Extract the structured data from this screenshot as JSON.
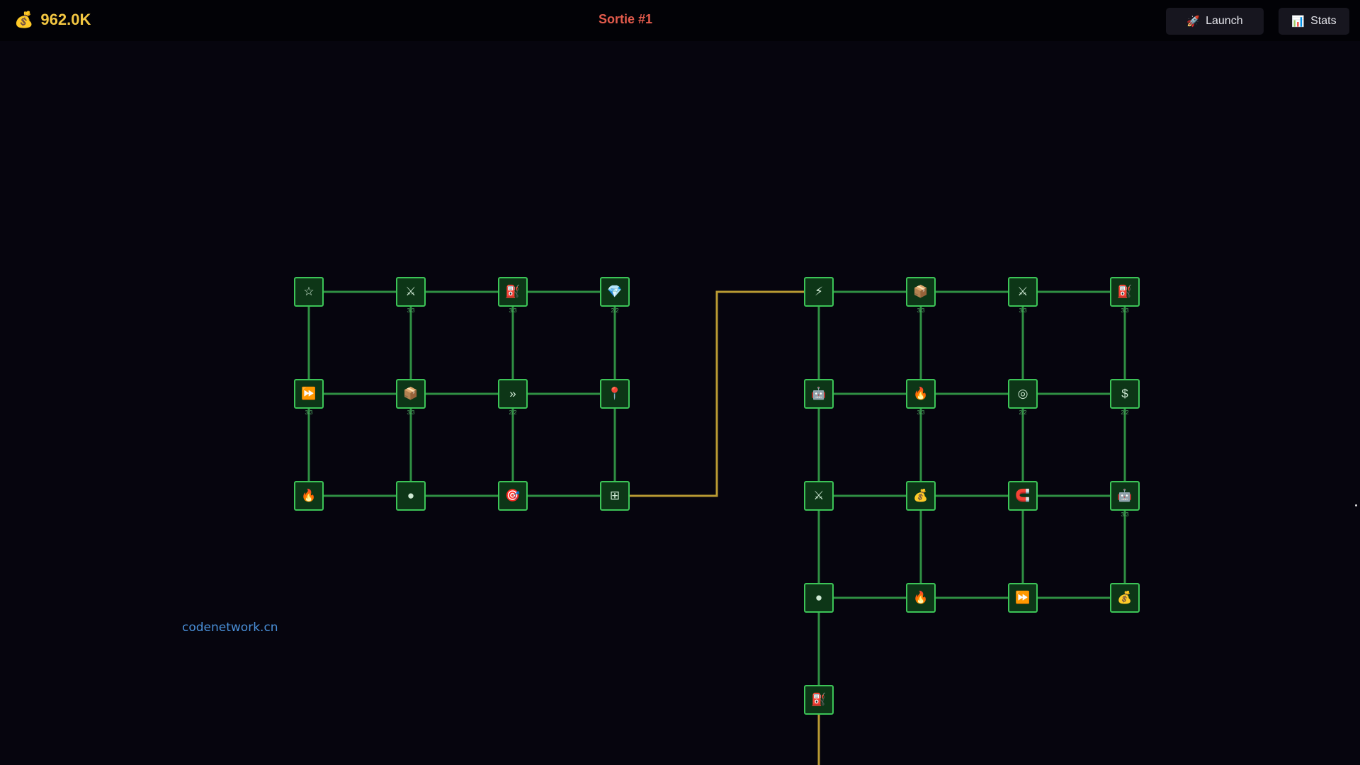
{
  "header": {
    "currency_icon": "money-bag-icon",
    "currency_glyph": "💰",
    "currency_value": "962.0K",
    "sortie_title": "Sortie #1",
    "launch_label": "Launch",
    "launch_icon": "rocket-icon",
    "launch_glyph": "🚀",
    "stats_label": "Stats",
    "stats_icon": "bar-chart-icon",
    "stats_glyph": "📊"
  },
  "watermark": "codenetwork.cn",
  "colors": {
    "background": "#06050e",
    "node_border": "#3cc457",
    "node_fill": "#0d3617",
    "link_green": "#2f8f43",
    "link_gold": "#b89a33",
    "currency_text": "#f3c742",
    "title_text": "#e35b4c"
  },
  "nodes": [
    {
      "id": "n1",
      "icon": "star-icon",
      "glyph": "☆",
      "level": ""
    },
    {
      "id": "n2",
      "icon": "crossed-swords-icon",
      "glyph": "⚔",
      "level": "3/3"
    },
    {
      "id": "n3",
      "icon": "fuel-pump-icon",
      "glyph": "⛽",
      "level": "3/3"
    },
    {
      "id": "n4",
      "icon": "gem-icon",
      "glyph": "💎",
      "level": "2/2"
    },
    {
      "id": "n5",
      "icon": "fast-forward-icon",
      "glyph": "⏩",
      "level": "3/3"
    },
    {
      "id": "n6",
      "icon": "package-icon",
      "glyph": "📦",
      "level": "3/3"
    },
    {
      "id": "n7",
      "icon": "double-chevron-icon",
      "glyph": "»",
      "level": "2/2"
    },
    {
      "id": "n8",
      "icon": "pin-icon",
      "glyph": "📍",
      "level": ""
    },
    {
      "id": "n9",
      "icon": "fire-icon",
      "glyph": "🔥",
      "level": ""
    },
    {
      "id": "n10",
      "icon": "dot-icon",
      "glyph": "●",
      "level": ""
    },
    {
      "id": "n11",
      "icon": "target-icon",
      "glyph": "🎯",
      "level": ""
    },
    {
      "id": "n12",
      "icon": "grid-icon",
      "glyph": "⊞",
      "level": ""
    },
    {
      "id": "n13",
      "icon": "lightning-icon",
      "glyph": "⚡",
      "level": ""
    },
    {
      "id": "n14",
      "icon": "package-icon",
      "glyph": "📦",
      "level": "3/3"
    },
    {
      "id": "n15",
      "icon": "crossed-swords-icon",
      "glyph": "⚔",
      "level": "3/3"
    },
    {
      "id": "n16",
      "icon": "fuel-pump-icon",
      "glyph": "⛽",
      "level": "3/3"
    },
    {
      "id": "n17",
      "icon": "robot-icon",
      "glyph": "🤖",
      "level": ""
    },
    {
      "id": "n18",
      "icon": "fire-icon",
      "glyph": "🔥",
      "level": "3/3"
    },
    {
      "id": "n19",
      "icon": "ring-icon",
      "glyph": "◎",
      "level": "2/2"
    },
    {
      "id": "n20",
      "icon": "dollar-icon",
      "glyph": "$",
      "level": "2/2"
    },
    {
      "id": "n21",
      "icon": "crossed-swords-icon",
      "glyph": "⚔",
      "level": ""
    },
    {
      "id": "n22",
      "icon": "money-bag-icon",
      "glyph": "💰",
      "level": ""
    },
    {
      "id": "n23",
      "icon": "magnet-icon",
      "glyph": "🧲",
      "level": ""
    },
    {
      "id": "n24",
      "icon": "robot-icon",
      "glyph": "🤖",
      "level": "3/3"
    },
    {
      "id": "n25",
      "icon": "dot-icon",
      "glyph": "●",
      "level": ""
    },
    {
      "id": "n26",
      "icon": "fire-icon",
      "glyph": "🔥",
      "level": ""
    },
    {
      "id": "n27",
      "icon": "fast-forward-icon",
      "glyph": "⏩",
      "level": ""
    },
    {
      "id": "n28",
      "icon": "money-bag-icon",
      "glyph": "💰",
      "level": ""
    },
    {
      "id": "n29",
      "icon": "fuel-pump-icon",
      "glyph": "⛽",
      "level": ""
    }
  ]
}
